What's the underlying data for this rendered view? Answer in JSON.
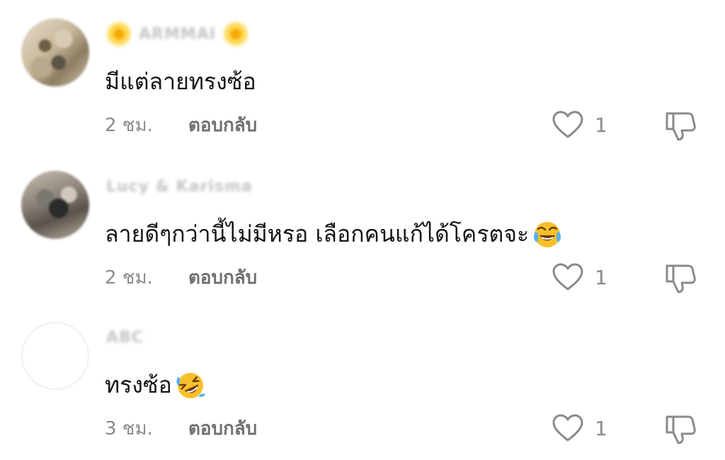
{
  "comments": [
    {
      "username": "ARMMAI",
      "avatar": "blurred-photo-avatar",
      "text": "มีแต่ลายทรงซ้อ",
      "emoji": "",
      "time": "2 ชม.",
      "reply_label": "ตอบกลับ",
      "likes": "1"
    },
    {
      "username": "Lucy & Karisma",
      "avatar": "blurred-photo-avatar",
      "text": "ลายดีๆกว่านี้ไม่มีหรอ เลือกคนแก้ได้โครตจะ",
      "emoji": "face-with-tears-of-joy",
      "time": "2 ชม.",
      "reply_label": "ตอบกลับ",
      "likes": "1"
    },
    {
      "username": "ABC",
      "avatar": "blank-avatar",
      "text": "ทรงซ้อ",
      "emoji": "rolling-on-floor-laughing",
      "time": "3 ชม.",
      "reply_label": "ตอบกลับ",
      "likes": "1"
    }
  ],
  "icons": {
    "like": "heart-outline-icon",
    "dislike": "thumbs-down-outline-icon"
  },
  "colors": {
    "text": "#161616",
    "meta": "#8a8a8a",
    "emoji_yellow": "#f7c02b"
  }
}
